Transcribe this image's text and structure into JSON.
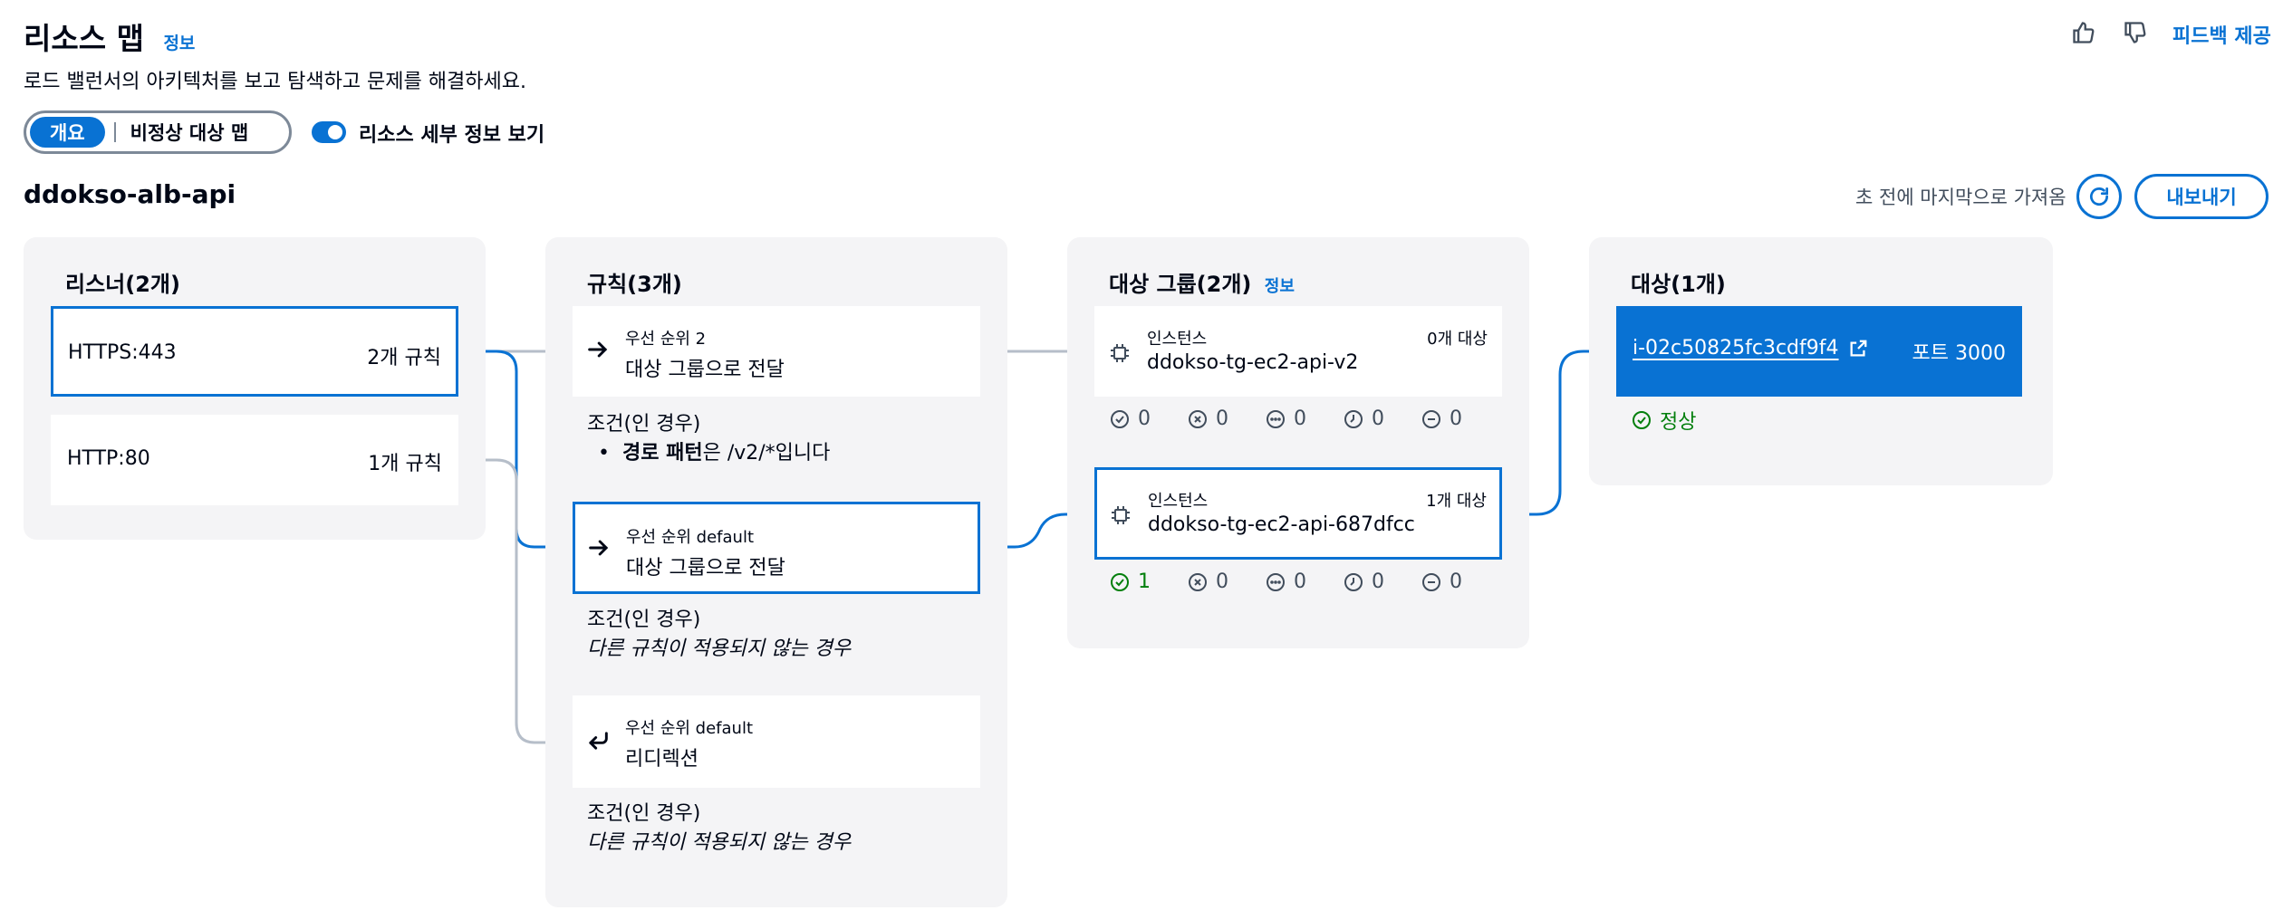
{
  "header": {
    "title": "리소스 맵",
    "info_label": "정보",
    "subtitle": "로드 밸런서의 아키텍처를 보고 탐색하고 문제를 해결하세요.",
    "feedback_label": "피드백 제공",
    "thumbs_up_icon": "thumbs-up-icon",
    "thumbs_down_icon": "thumbs-down-icon"
  },
  "view": {
    "segments": [
      "개요",
      "비정상 대상 맵"
    ],
    "selected": "개요",
    "toggle_label": "리소스 세부 정보 보기",
    "toggle_on": true
  },
  "load_balancer": {
    "name": "ddokso-alb-api",
    "last_fetched": "초 전에 마지막으로 가져옴",
    "export_label": "내보내기"
  },
  "listeners": {
    "title": "리스너(2개)",
    "items": [
      {
        "name": "HTTPS:443",
        "rules": "2개 규칙",
        "selected": true
      },
      {
        "name": "HTTP:80",
        "rules": "1개 규칙",
        "selected": false
      }
    ]
  },
  "rules": {
    "title": "규칙(3개)",
    "items": [
      {
        "priority": "우선 순위 2",
        "action": "대상 그룹으로 전달",
        "cond_title": "조건(인 경우)",
        "cond_bold": "경로 패턴",
        "cond_rest": "은 /v2/*입니다",
        "selected": false
      },
      {
        "priority": "우선 순위 default",
        "action": "대상 그룹으로 전달",
        "cond_title": "조건(인 경우)",
        "cond_text": "다른 규칙이 적용되지 않는 경우",
        "selected": true
      },
      {
        "priority": "우선 순위 default",
        "action": "리디렉션",
        "cond_title": "조건(인 경우)",
        "cond_text": "다른 규칙이 적용되지 않는 경우",
        "selected": false
      }
    ]
  },
  "target_groups": {
    "title": "대상 그룹(2개)",
    "info_label": "정보",
    "items": [
      {
        "type": "인스턴스",
        "count": "0개 대상",
        "name": "ddokso-tg-ec2-api-v2",
        "selected": false,
        "stats": [
          "0",
          "0",
          "0",
          "0",
          "0"
        ]
      },
      {
        "type": "인스턴스",
        "count": "1개 대상",
        "name": "ddokso-tg-ec2-api-687dfcc",
        "selected": true,
        "stats": [
          "1",
          "0",
          "0",
          "0",
          "0"
        ]
      }
    ],
    "stat_icons": [
      "healthy-icon",
      "unhealthy-icon",
      "unused-icon",
      "draining-icon",
      "unavailable-icon"
    ]
  },
  "targets": {
    "title": "대상(1개)",
    "items": [
      {
        "id": "i-02c50825fc3cdf9f4",
        "port": "포트 3000",
        "status": "정상"
      }
    ]
  },
  "colors": {
    "accent": "#0972d3",
    "success": "#037f0c",
    "panel_bg": "#f4f4f6",
    "connector_gray": "#b6bec9"
  }
}
